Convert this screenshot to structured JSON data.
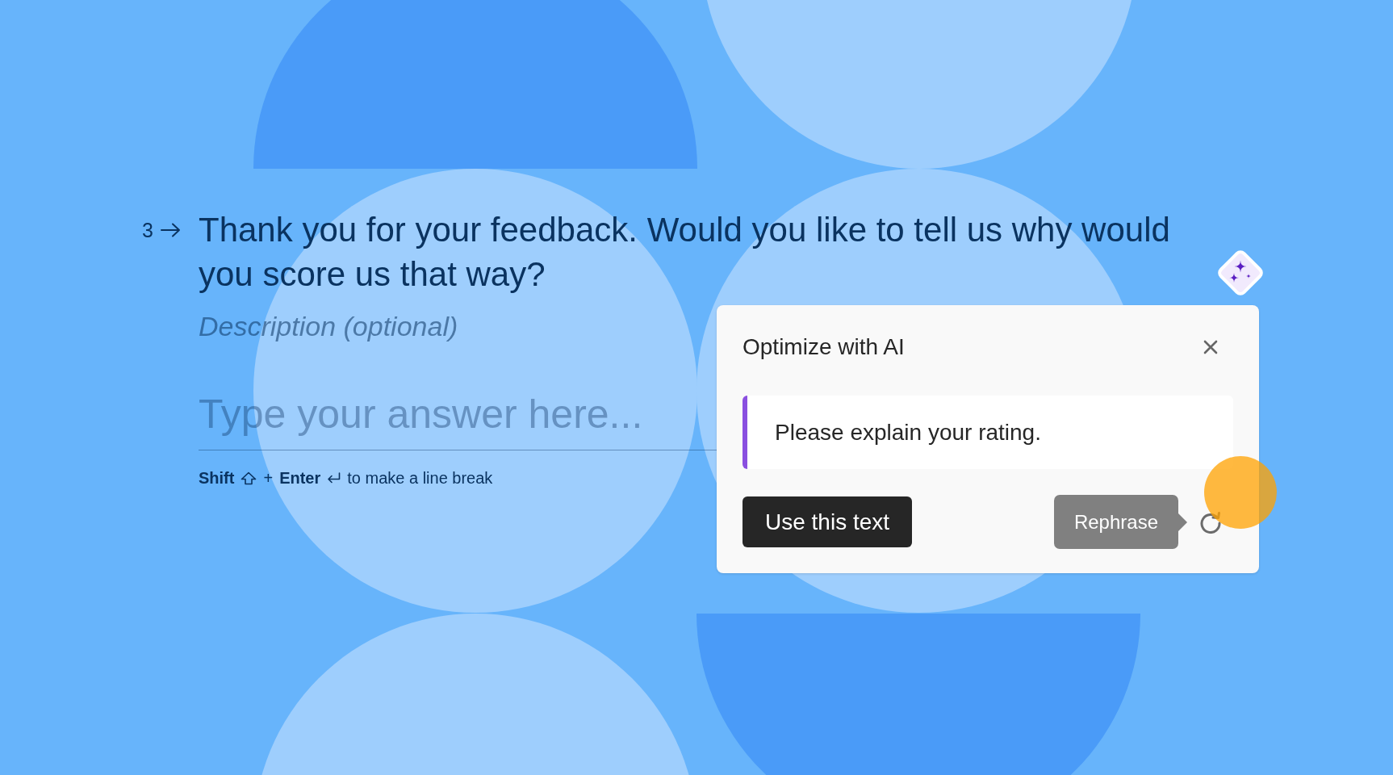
{
  "question": {
    "number": "3",
    "title": "Thank you for your feedback. Would you like to tell us why would you score us that way?",
    "description": "Description (optional)"
  },
  "answer": {
    "placeholder": "Type your answer here..."
  },
  "hint": {
    "shift": "Shift",
    "plus": "+",
    "enter": "Enter",
    "text": "to make a line break"
  },
  "ai_panel": {
    "title": "Optimize with AI",
    "suggestion": "Please explain your rating.",
    "primary_button": "Use this text",
    "tooltip": "Rephrase"
  }
}
